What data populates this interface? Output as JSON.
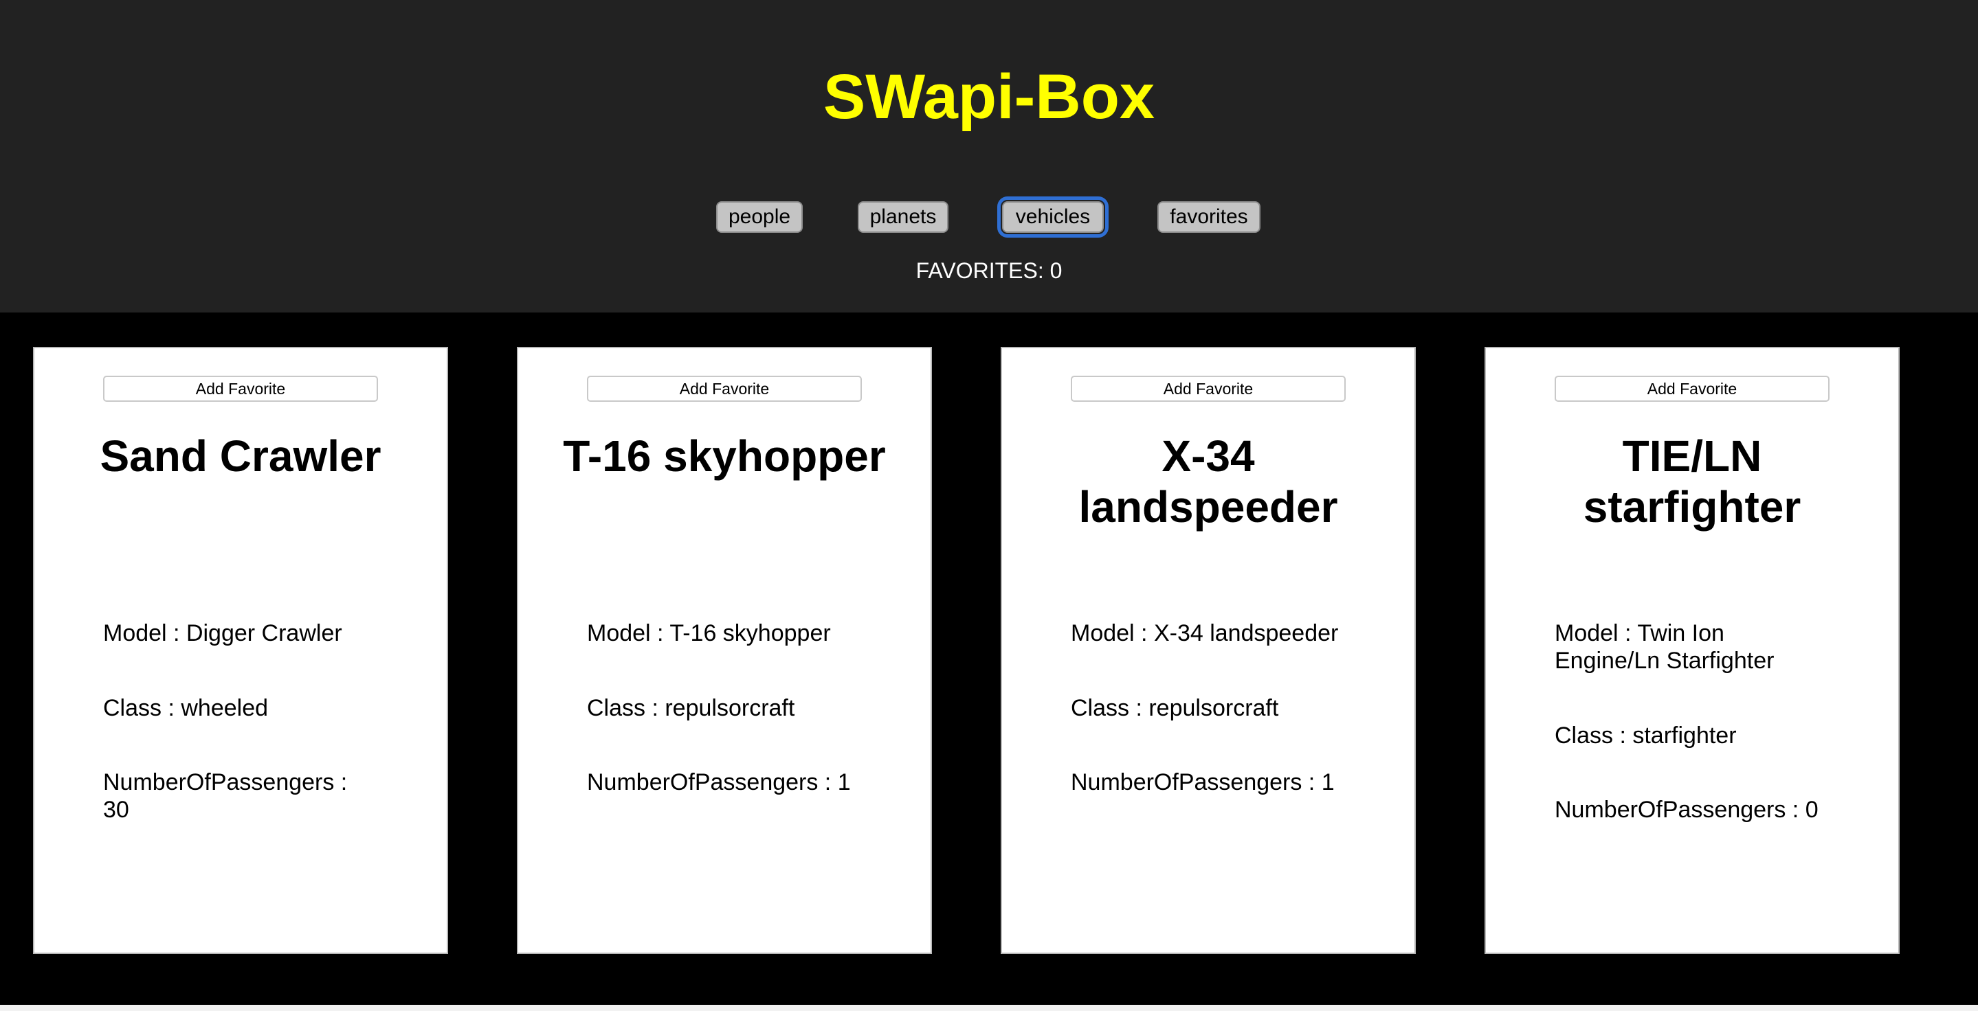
{
  "app": {
    "title": "SWapi-Box"
  },
  "nav": {
    "buttons": [
      {
        "label": "people"
      },
      {
        "label": "planets"
      },
      {
        "label": "vehicles",
        "active": true
      },
      {
        "label": "favorites"
      }
    ]
  },
  "favorites": {
    "count_text": "FAVORITES: 0"
  },
  "colors": {
    "header_bg": "#222222",
    "title": "#ffff00",
    "cards_bg": "#000000",
    "active_outline": "#2f6fd4"
  },
  "cards": [
    {
      "add_label": "Add Favorite",
      "name": "Sand Crawler",
      "model": "Model : Digger Crawler",
      "class": "Class : wheeled",
      "passengers": "NumberOfPassengers : 30"
    },
    {
      "add_label": "Add Favorite",
      "name": "T-16 skyhopper",
      "model": "Model : T-16 skyhopper",
      "class": "Class : repulsorcraft",
      "passengers": "NumberOfPassengers : 1"
    },
    {
      "add_label": "Add Favorite",
      "name": "X-34 landspeeder",
      "model": "Model : X-34 landspeeder",
      "class": "Class : repulsorcraft",
      "passengers": "NumberOfPassengers : 1"
    },
    {
      "add_label": "Add Favorite",
      "name": "TIE/LN starfighter",
      "model": "Model : Twin Ion Engine/Ln Starfighter",
      "class": "Class : starfighter",
      "passengers": "NumberOfPassengers : 0"
    }
  ]
}
